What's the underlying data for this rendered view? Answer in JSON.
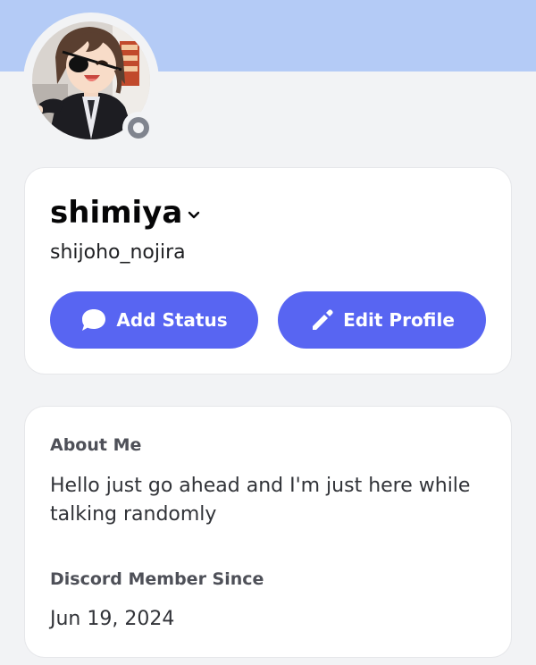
{
  "profile": {
    "display_name": "shimiya",
    "username": "shijoho_nojira",
    "status": "offline"
  },
  "actions": {
    "add_status_label": "Add Status",
    "edit_profile_label": "Edit Profile"
  },
  "about": {
    "heading": "About Me",
    "text": "Hello just go ahead and I'm just here while talking randomly"
  },
  "member_since": {
    "heading": "Discord Member Since",
    "date": "Jun 19, 2024"
  },
  "colors": {
    "banner": "#b4cbf6",
    "accent": "#5865f2",
    "background": "#f2f3f5",
    "status_offline": "#80848e"
  },
  "icons": {
    "add_status": "speech-bubble-icon",
    "edit_profile": "pencil-icon",
    "name_dropdown": "chevron-down-icon"
  }
}
